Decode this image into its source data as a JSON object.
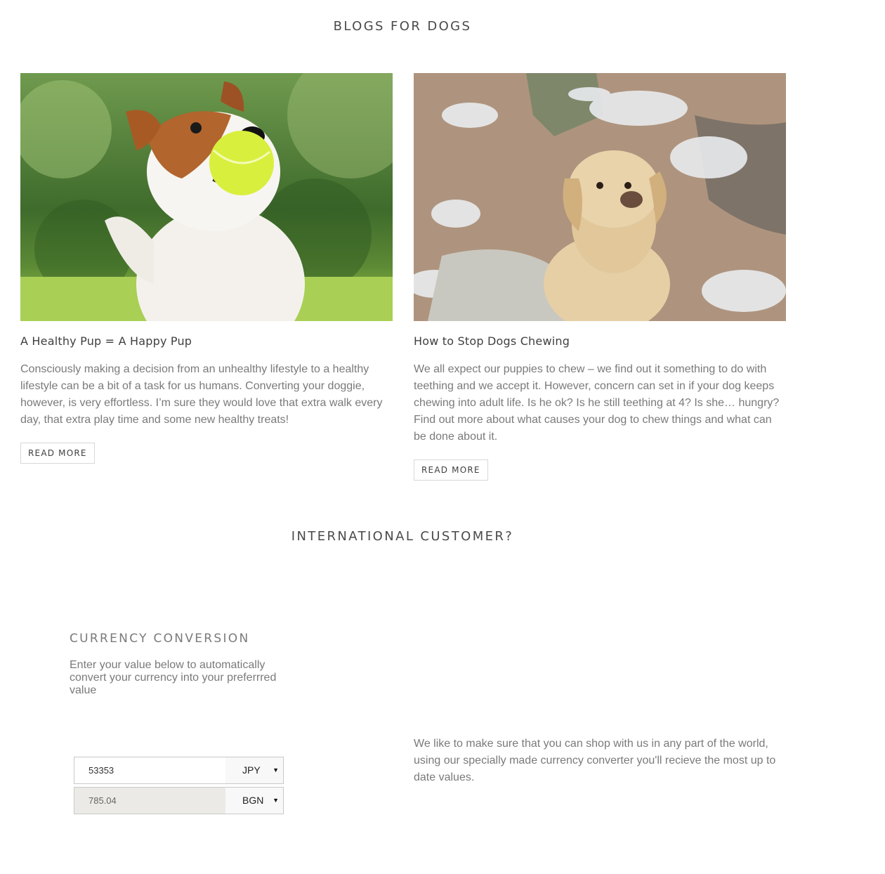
{
  "blogs_section": {
    "title": "BLOGS FOR DOGS",
    "posts": [
      {
        "image_alt": "jack russell terrier with tennis ball",
        "title": "A Healthy Pup = A Happy Pup",
        "excerpt": "Consciously making a decision from an unhealthy lifestyle to a healthy lifestyle can be a bit of a task for us humans. Converting your doggie, however, is very effortless. I’m sure they would love that extra walk every day, that extra play time and some new healthy treats!",
        "button_label": "READ MORE"
      },
      {
        "image_alt": "labrador sitting among chewed stuffing",
        "title": "How to Stop Dogs Chewing",
        "excerpt": "We all expect our puppies to chew – we find out it something to do with teething and we accept it. However, concern can set in if your dog keeps chewing into adult life. Is he ok? Is he still teething at 4? Is she… hungry? Find out more about what causes your dog to chew things and what can be done about it.",
        "button_label": "READ MORE"
      }
    ]
  },
  "international_section": {
    "title": "INTERNATIONAL CUSTOMER?",
    "converter": {
      "title": "CURRENCY CONVERSION",
      "description": "Enter your value below to automatically convert your currency into your preferrred value",
      "from_value": "53353",
      "from_currency": "JPY",
      "to_value": "785.04",
      "to_currency": "BGN"
    },
    "info_text": "We like to make sure that you can shop with us in any part of the world, using our specially made currency converter you'll recieve the most up to date values."
  }
}
